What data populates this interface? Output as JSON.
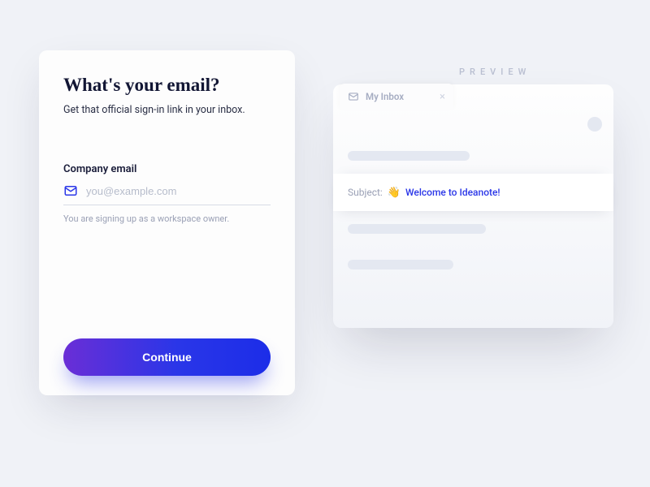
{
  "signup": {
    "title": "What's your email?",
    "subtitle": "Get that official sign-in link in your inbox.",
    "field_label": "Company email",
    "placeholder": "you@example.com",
    "value": "",
    "helper": "You are signing up as a workspace owner.",
    "continue_label": "Continue"
  },
  "preview": {
    "label": "PREVIEW",
    "tab_label": "My Inbox",
    "subject_prefix": "Subject:",
    "subject_emoji": "👋",
    "subject_text": "Welcome to Ideanote!"
  },
  "colors": {
    "accent_blue": "#2a36e8",
    "accent_purple": "#6a2ed6"
  }
}
